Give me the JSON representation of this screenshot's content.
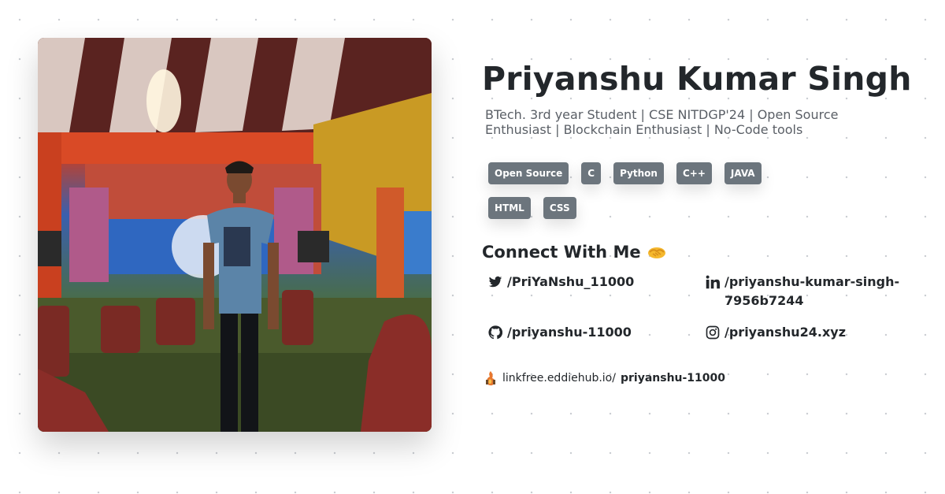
{
  "profile": {
    "name": "Priyanshu Kumar Singh",
    "bio": "BTech. 3rd year Student | CSE NITDGP'24 | Open Source Enthusiast | Blockchain Enthusiast | No-Code tools",
    "photo_icon": "profile-photo"
  },
  "tags": [
    "Open Source",
    "C",
    "Python",
    "C++",
    "JAVA",
    "HTML",
    "CSS"
  ],
  "connect": {
    "heading": "Connect With Me",
    "heading_icon": "handshake-icon",
    "twitter": "/PriYaNshu_11000",
    "linkedin": "/priyanshu-kumar-singh-7956b7244",
    "github": "/priyanshu-11000",
    "instagram": "/priyanshu24.xyz"
  },
  "linkfree": {
    "domain": "linkfree.eddiehub.io/",
    "username": "priyanshu-11000",
    "icon": "linkfree-icon"
  },
  "colors": {
    "tag_bg": "#6c757d",
    "heading": "#23272b",
    "bio": "#5a5f66"
  }
}
